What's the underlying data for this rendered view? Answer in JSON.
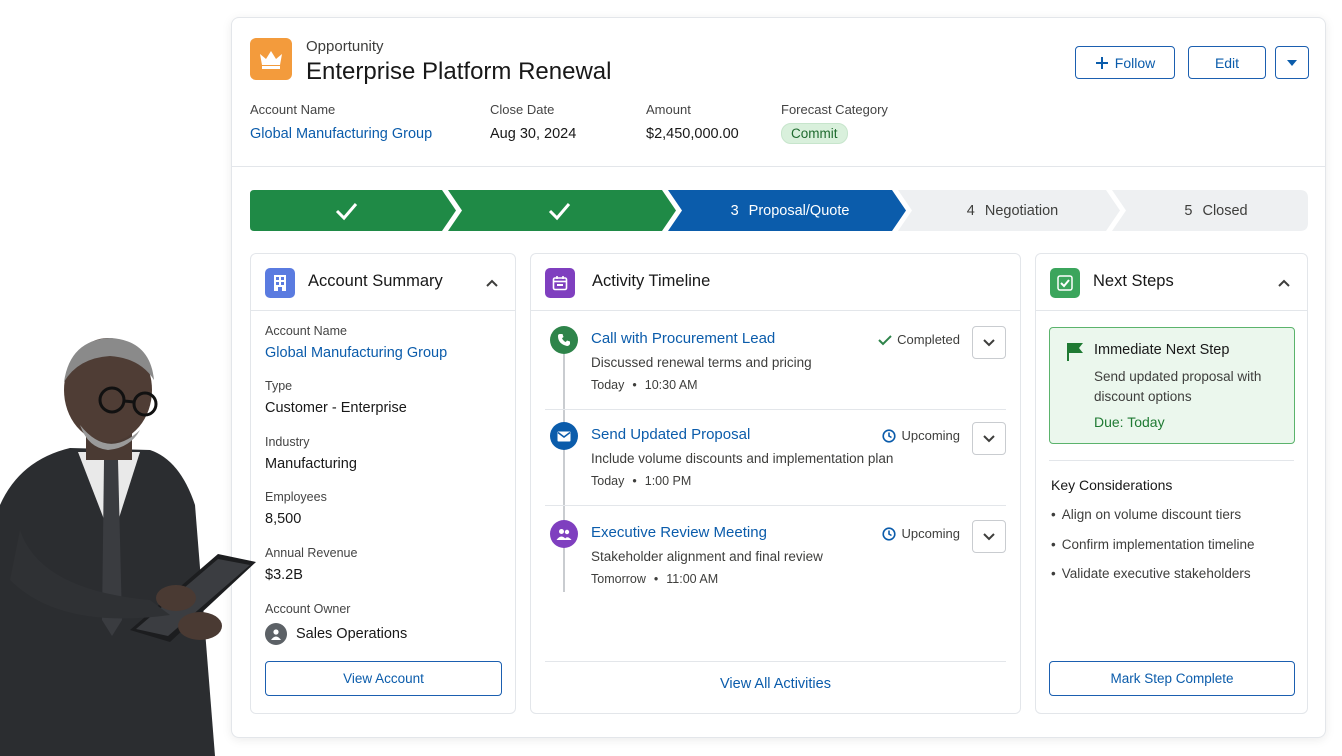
{
  "record": {
    "object_label": "Opportunity",
    "title": "Enterprise Platform Renewal",
    "actions": {
      "follow": "Follow",
      "edit": "Edit"
    },
    "fields": [
      {
        "label": "Account Name",
        "value": "Global Manufacturing Group",
        "link": true
      },
      {
        "label": "Close Date",
        "value": "Aug 30, 2024"
      },
      {
        "label": "Amount",
        "value": "$2,450,000.00"
      },
      {
        "label": "Forecast Category",
        "value": "Commit",
        "badge": true
      }
    ]
  },
  "path": {
    "stages": [
      {
        "number": "",
        "label": "",
        "state": "complete"
      },
      {
        "number": "",
        "label": "",
        "state": "complete"
      },
      {
        "number": "3",
        "label": "Proposal/Quote",
        "state": "current"
      },
      {
        "number": "4",
        "label": "Negotiation",
        "state": "incomplete"
      },
      {
        "number": "5",
        "label": "Closed",
        "state": "incomplete"
      }
    ]
  },
  "account_summary": {
    "title": "Account Summary",
    "fields": [
      {
        "label": "Account Name",
        "value": "Global Manufacturing Group",
        "link": true
      },
      {
        "label": "Type",
        "value": "Customer - Enterprise"
      },
      {
        "label": "Industry",
        "value": "Manufacturing"
      },
      {
        "label": "Employees",
        "value": "8,500"
      },
      {
        "label": "Annual Revenue",
        "value": "$3.2B"
      },
      {
        "label": "Account Owner",
        "value": "Sales Operations"
      }
    ],
    "button": "View Account"
  },
  "activity": {
    "title": "Activity Timeline",
    "items": [
      {
        "title": "Call with Procurement Lead",
        "description": "Discussed renewal terms and pricing",
        "day": "Today",
        "time": "10:30 AM",
        "status": "Completed",
        "icon": "phone-icon",
        "icon_color": "#2e844a"
      },
      {
        "title": "Send Updated Proposal",
        "description": "Include volume discounts and implementation plan",
        "day": "Today",
        "time": "1:00 PM",
        "status": "Upcoming",
        "icon": "email-icon",
        "icon_color": "#0b5cab"
      },
      {
        "title": "Executive Review Meeting",
        "description": "Stakeholder alignment and final review",
        "day": "Tomorrow",
        "time": "11:00 AM",
        "status": "Upcoming",
        "icon": "meeting-icon",
        "icon_color": "#7f3fbf"
      }
    ],
    "view_all": "View All Activities"
  },
  "next_steps": {
    "title": "Next Steps",
    "immediate": {
      "title": "Immediate Next Step",
      "description": "Send updated proposal with discount options",
      "due": "Due: Today"
    },
    "considerations_title": "Key Considerations",
    "considerations": [
      "Align on volume discount tiers",
      "Confirm implementation timeline",
      "Validate executive stakeholders"
    ],
    "button": "Mark Step Complete"
  },
  "colors": {
    "complete": "#1f8a46",
    "current": "#0b5cab",
    "incomplete": "#eef0f2",
    "link": "#0b5cab",
    "opportunity_icon": "#f39b3c"
  }
}
